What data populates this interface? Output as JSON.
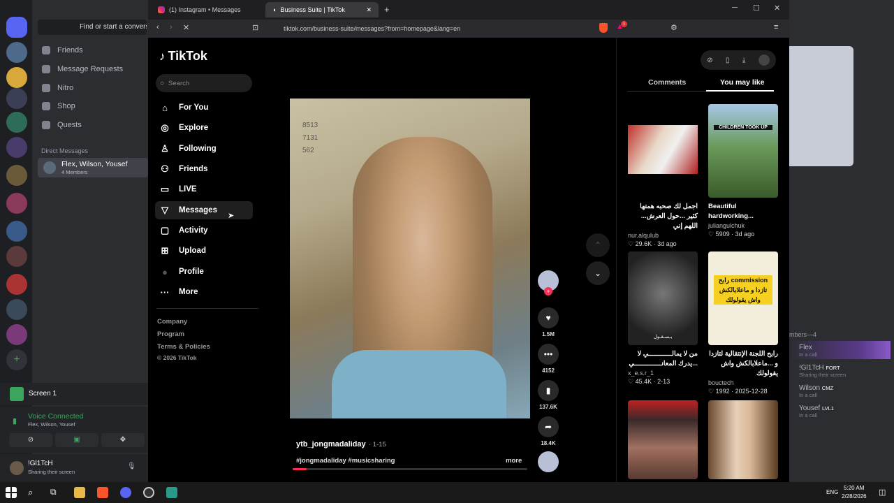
{
  "discord": {
    "search_label": "Find or start a conversat",
    "nav": [
      "Friends",
      "Message Requests",
      "Nitro",
      "Shop",
      "Quests"
    ],
    "dm_header": "Direct Messages",
    "group_name": "Flex, Wilson, Yousef",
    "group_members": "4 Members",
    "screen_label": "Screen 1",
    "voice_status": "Voice Connected",
    "voice_members": "Flex, Wilson, Yousef",
    "user_name": "!Gl1TcH",
    "user_status": "Sharing their screen",
    "badge_count": "1",
    "badge_count2": "2",
    "members_header": "mbers—4",
    "members": [
      {
        "name": "Flex",
        "status": "In a call",
        "tag": ""
      },
      {
        "name": "!Gl1TcH",
        "status": "Sharing their screen",
        "tag": "FORT"
      },
      {
        "name": "Wilson",
        "status": "In a call",
        "tag": "CMZ"
      },
      {
        "name": "Yousef",
        "status": "In a call",
        "tag": "LVL1"
      }
    ]
  },
  "browser": {
    "tabs": [
      {
        "title": "(1) Instagram • Messages",
        "active": false
      },
      {
        "title": "Business Suite | TikTok",
        "active": true
      }
    ],
    "url": "tiktok.com/business-suite/messages?from=homepage&lang=en",
    "notif": "1"
  },
  "tiktok": {
    "logo": "TikTok",
    "search_placeholder": "Search",
    "nav": [
      {
        "label": "For You",
        "icon": "home-icon"
      },
      {
        "label": "Explore",
        "icon": "compass-icon"
      },
      {
        "label": "Following",
        "icon": "user-follow-icon"
      },
      {
        "label": "Friends",
        "icon": "friends-icon"
      },
      {
        "label": "LIVE",
        "icon": "live-icon"
      },
      {
        "label": "Messages",
        "icon": "send-icon"
      },
      {
        "label": "Activity",
        "icon": "activity-icon"
      },
      {
        "label": "Upload",
        "icon": "upload-icon"
      },
      {
        "label": "Profile",
        "icon": "profile-icon"
      },
      {
        "label": "More",
        "icon": "more-icon"
      }
    ],
    "footer": [
      "Company",
      "Program",
      "Terms & Policies",
      "© 2026 TikTok"
    ],
    "video": {
      "author": "ytb_jongmadaliday",
      "date": "· 1-15",
      "hashtags": "#jongmadaliday #musicsharing",
      "more": "more",
      "overlay_numbers": "8513 7131 562",
      "progress": 0.06
    },
    "actions": [
      {
        "icon": "heart-icon",
        "count": "1.5M"
      },
      {
        "icon": "comment-icon",
        "count": "4152"
      },
      {
        "icon": "bookmark-icon",
        "count": "137.6K"
      },
      {
        "icon": "share-icon",
        "count": "18.4K"
      }
    ],
    "panel_tabs": [
      "Comments",
      "You may like"
    ],
    "cards": [
      {
        "title": "اجمل لك صحبه همتها كثير ...حول العرش... اللهم إني",
        "author": "nur.alqulub",
        "likes": "29.6K",
        "date": "3d ago"
      },
      {
        "title": "Beautiful hardworking...",
        "author": "juliangulchuk",
        "likes": "5909",
        "date": "3d ago",
        "thumb_text": "CHILDREN TOOK UP"
      },
      {
        "title": "من لا يمالــــــــــــي لا ...يدرك المعانــــــــــــــي",
        "author": "x_e.s.r_1",
        "likes": "45.4K",
        "date": "2-13",
        "thumb_text": "بـسـقـول"
      },
      {
        "title": "رابح اللجنة الإنتقالية لتازدا و ...ماعلابالكش واش يقولولك",
        "author": "bouctech",
        "likes": "1992",
        "date": "2025-12-28",
        "thumb_text": "رابح commission تازدا و ماعلابالكش واش يقولولك"
      }
    ]
  },
  "taskbar": {
    "lang": "ENG",
    "time": "5:20 AM",
    "date": "2/28/2026"
  }
}
